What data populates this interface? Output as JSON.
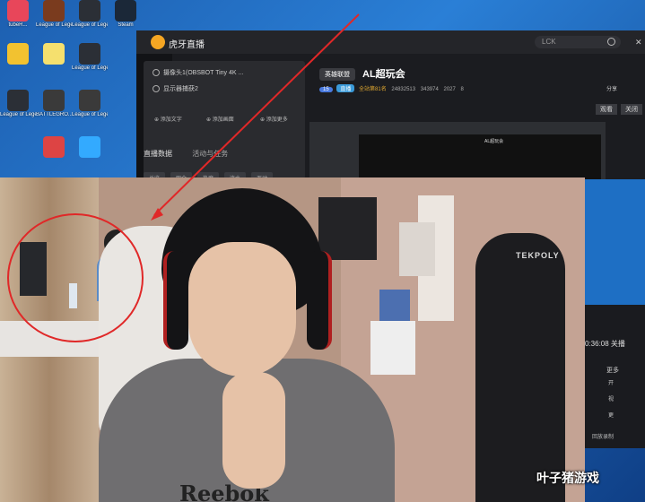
{
  "desktop": {
    "icons": [
      {
        "label": "tubeR...",
        "color": "#e8465a"
      },
      {
        "label": "League of Legends",
        "color": "#7a3b1e"
      },
      {
        "label": "League of Legends",
        "color": "#2b2f36"
      },
      {
        "label": "Steam",
        "color": "#1b2838"
      },
      {
        "label": "",
        "color": "#f2c230"
      },
      {
        "label": "",
        "color": "#f5e06e"
      },
      {
        "label": "League of Legends",
        "color": "#2b2f36"
      },
      {
        "label": "League of Legends",
        "color": "#2b2f36"
      },
      {
        "label": "BATTLEGRO...",
        "color": "#3a3a3a"
      },
      {
        "label": "League of Legends",
        "color": "#3a3a3a"
      },
      {
        "label": "",
        "color": "#d44"
      },
      {
        "label": "",
        "color": "#3af"
      }
    ]
  },
  "app": {
    "brand": "虎牙直播",
    "search_placeholder": "LCK",
    "sources": [
      "摄像头1(OBSBOT Tiny 4K ...",
      "显示器捕获2"
    ],
    "add_buttons": [
      "添加文字",
      "添加画面",
      "添加更多"
    ],
    "tab_live_data": "直播数据",
    "tab_activity": "活动与任务",
    "subtabs": [
      "总览",
      "观众",
      "热度",
      "流水",
      "互动"
    ],
    "room_tag": "英雄联盟",
    "room_title": "AL超玩会",
    "meta": {
      "level": "15",
      "badge": "直播",
      "category": "全站第81名",
      "heat": "24832513",
      "subs": "343974",
      "fans": "2027",
      "sharecount": "8"
    },
    "share": "分享",
    "buttons": [
      "观看",
      "关闭"
    ],
    "preview_title": "AL超玩会"
  },
  "side": {
    "time": "0:36:08 关播",
    "more": "更多",
    "items": [
      "开",
      "视",
      "更"
    ],
    "rec": "回放录制"
  },
  "overlay": {
    "chair_brand": "TEKPOLY",
    "shirt_brand": "Reebok",
    "watermark": "叶子猪游戏"
  }
}
